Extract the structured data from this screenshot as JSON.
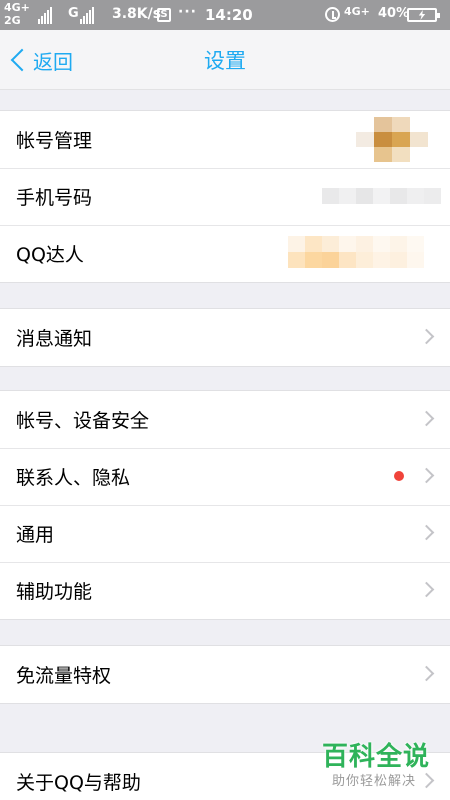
{
  "status_bar": {
    "net_top": "4G+",
    "net_bottom": "2G",
    "net2": "G",
    "speed": "3.8K/s",
    "s_icon": "S",
    "dots": "···",
    "time": "14:20",
    "net4g": "4G+",
    "battery": "40%",
    "icons": [
      "signal-icon",
      "s-notification-icon",
      "alarm-icon",
      "battery-charging-icon"
    ]
  },
  "nav": {
    "back_label": "返回",
    "title": "设置",
    "accent_color": "#1faaf1"
  },
  "groups": [
    {
      "items": [
        {
          "label": "帐号管理",
          "redacted": true
        },
        {
          "label": "手机号码",
          "redacted": true
        },
        {
          "label": "QQ达人",
          "redacted": true
        }
      ]
    },
    {
      "items": [
        {
          "label": "消息通知"
        }
      ]
    },
    {
      "items": [
        {
          "label": "帐号、设备安全"
        },
        {
          "label": "联系人、隐私",
          "badge": "red-dot"
        },
        {
          "label": "通用"
        },
        {
          "label": "辅助功能"
        }
      ]
    },
    {
      "items": [
        {
          "label": "免流量特权"
        }
      ]
    },
    {
      "items": [
        {
          "label": "关于QQ与帮助"
        }
      ]
    }
  ],
  "colors": {
    "background": "#efeff4",
    "status_bar": "#9b9b9d",
    "badge_red": "#f0433a",
    "watermark_green": "#2fb35a"
  },
  "watermark": {
    "main": "百科全说",
    "sub": "助你轻松解决"
  }
}
